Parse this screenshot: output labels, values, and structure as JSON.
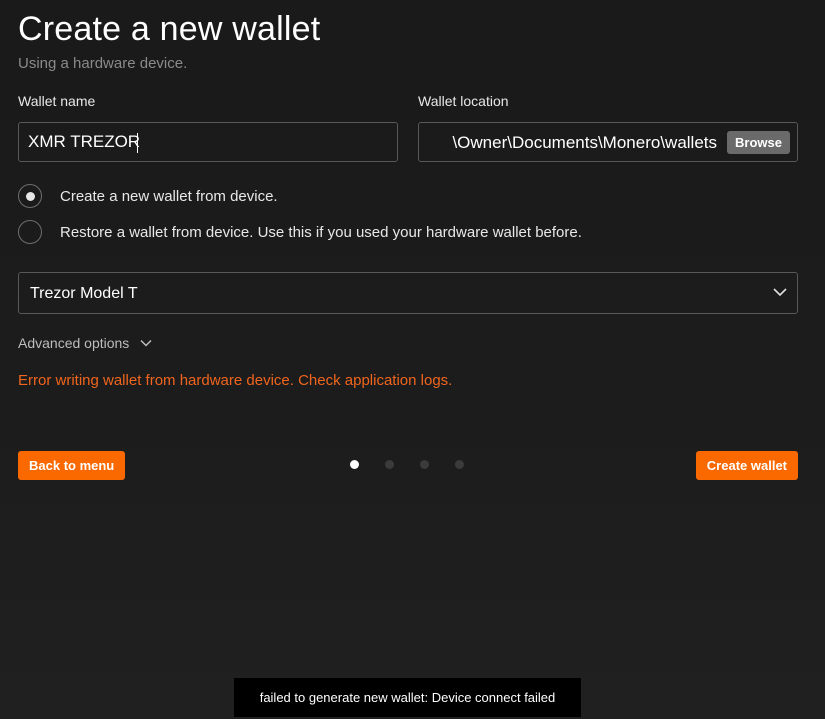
{
  "header": {
    "title": "Create a new wallet",
    "subtitle": "Using a hardware device."
  },
  "wallet_name": {
    "label": "Wallet name",
    "value": "XMR TREZOR"
  },
  "wallet_location": {
    "label": "Wallet location",
    "value": "\\Owner\\Documents\\Monero\\wallets",
    "browse_label": "Browse"
  },
  "options": [
    {
      "label": "Create a new wallet from device.",
      "selected": true
    },
    {
      "label": "Restore a wallet from device. Use this if you used your hardware wallet before.",
      "selected": false
    }
  ],
  "device_select": {
    "selected": "Trezor Model T",
    "icon": "chevron-down-icon"
  },
  "advanced": {
    "label": "Advanced options",
    "icon": "chevron-down-icon"
  },
  "error": {
    "text": "Error writing wallet from hardware device. Check application logs.",
    "color": "#f0651d"
  },
  "navigation": {
    "back_label": "Back to menu",
    "create_label": "Create wallet",
    "steps_total": 4,
    "current_step": 1
  },
  "toast": {
    "text": "failed to generate new wallet: Device connect failed"
  },
  "colors": {
    "accent": "#fa6800",
    "background": "#1c1c1c",
    "error": "#f0651d"
  }
}
